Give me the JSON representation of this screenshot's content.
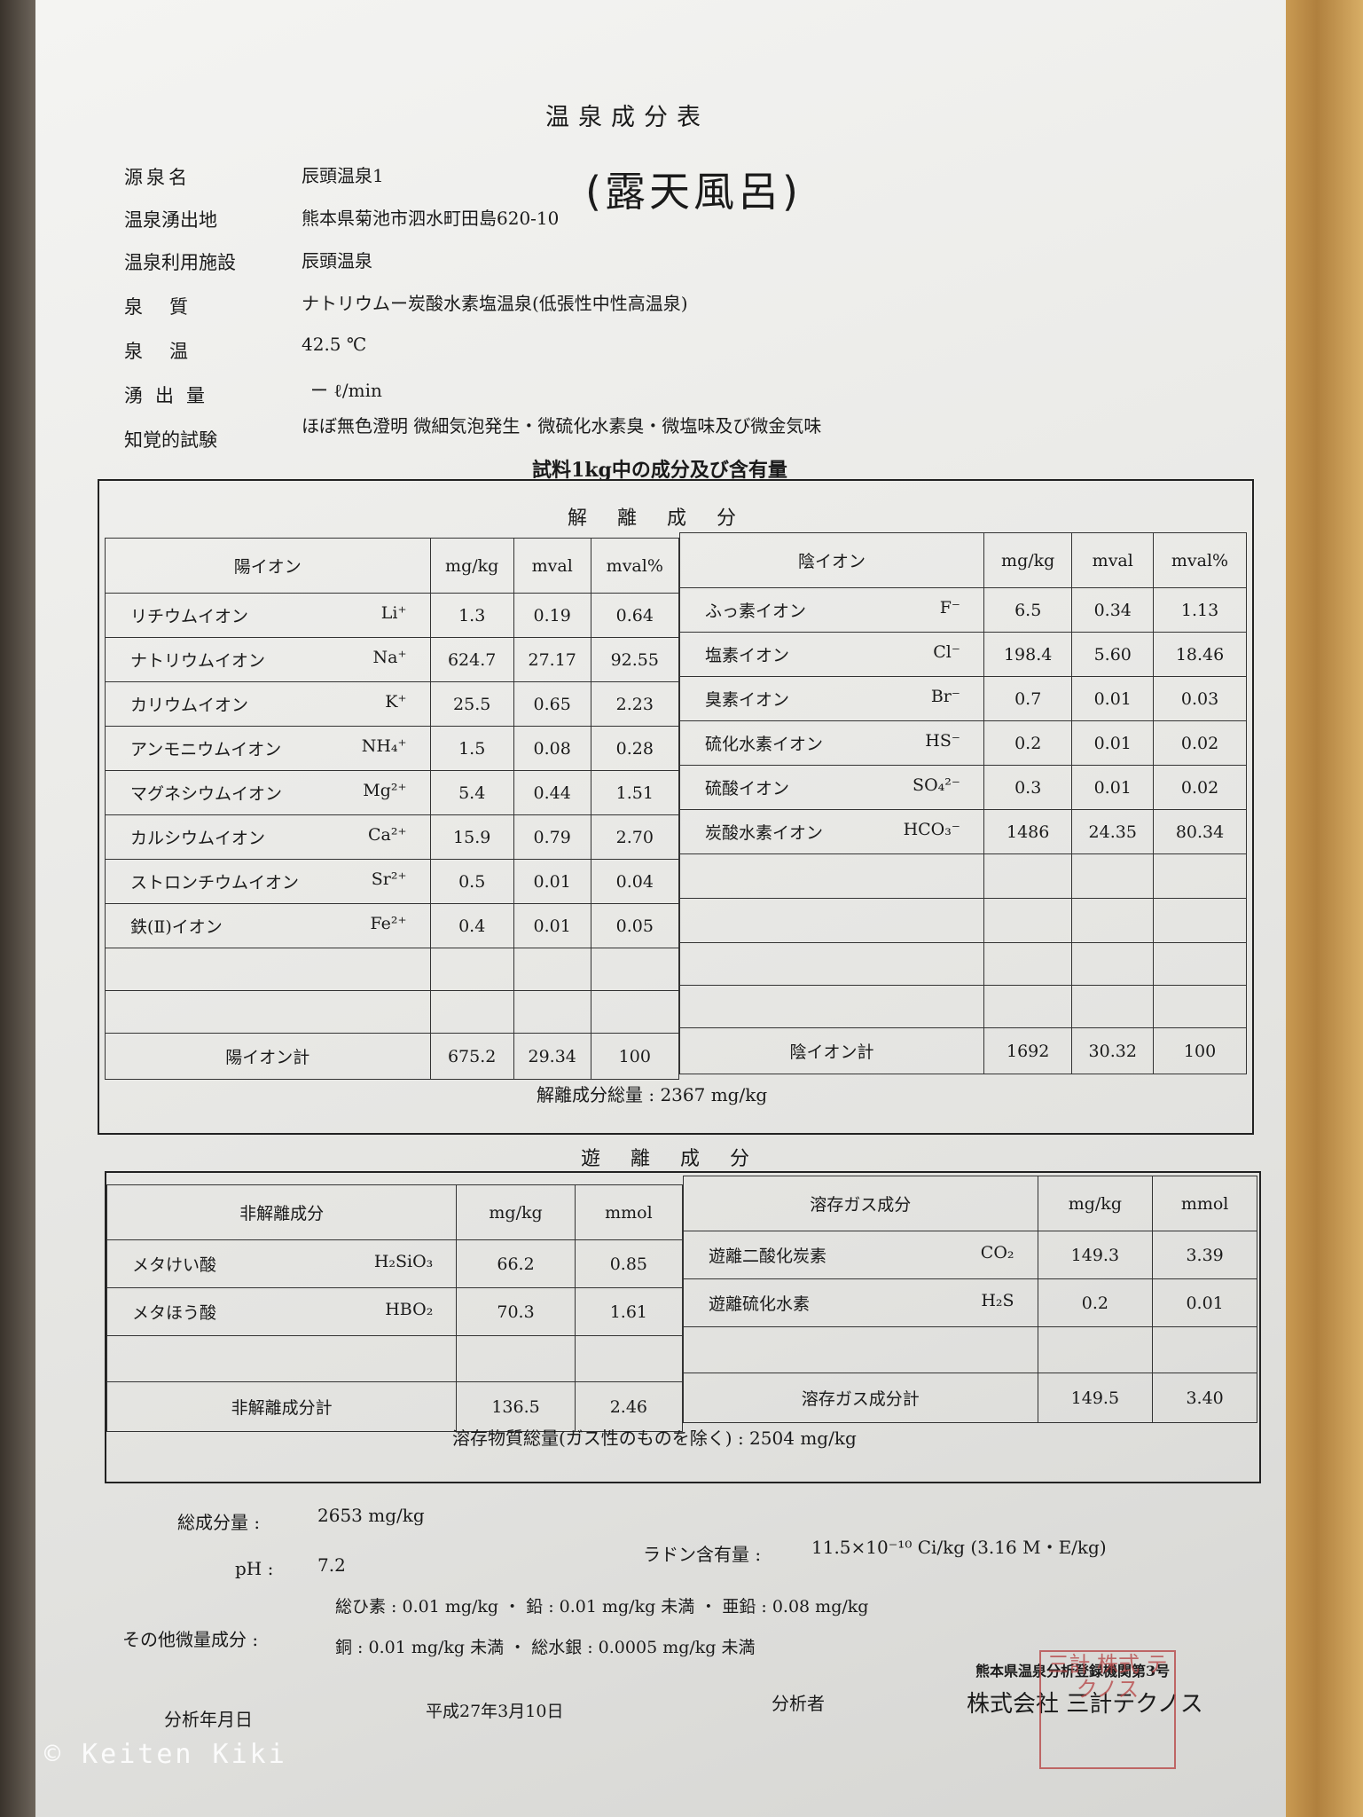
{
  "doc": {
    "title": "温泉成分表",
    "fields": [
      {
        "label": "源泉名",
        "value": "辰頭温泉1"
      },
      {
        "label": "温泉湧出地",
        "value": "熊本県菊池市泗水町田島620-10"
      },
      {
        "label": "温泉利用施設",
        "value": "辰頭温泉"
      },
      {
        "label": "泉質",
        "value": "ナトリウムー炭酸水素塩温泉(低張性中性高温泉)"
      },
      {
        "label": "泉温",
        "value": "42.5 ℃"
      },
      {
        "label": "湧出量",
        "value": "ー ℓ/min"
      },
      {
        "label": "知覚的試験",
        "value": "ほぼ無色澄明 微細気泡発生・微硫化水素臭・微塩味及び微金気味"
      }
    ],
    "handwritten": "(露天風呂)",
    "subtitle": "試料1kg中の成分及び含有量"
  },
  "dissociated": {
    "heading": "解離成分",
    "cat_headers": [
      "陽イオン",
      "mg/kg",
      "mval",
      "mval%"
    ],
    "an_headers": [
      "陰イオン",
      "mg/kg",
      "mval",
      "mval%"
    ],
    "cations": [
      {
        "name": "リチウムイオン",
        "sym": "Li⁺",
        "mg": "1.3",
        "mval": "0.19",
        "pct": "0.64"
      },
      {
        "name": "ナトリウムイオン",
        "sym": "Na⁺",
        "mg": "624.7",
        "mval": "27.17",
        "pct": "92.55"
      },
      {
        "name": "カリウムイオン",
        "sym": "K⁺",
        "mg": "25.5",
        "mval": "0.65",
        "pct": "2.23"
      },
      {
        "name": "アンモニウムイオン",
        "sym": "NH₄⁺",
        "mg": "1.5",
        "mval": "0.08",
        "pct": "0.28"
      },
      {
        "name": "マグネシウムイオン",
        "sym": "Mg²⁺",
        "mg": "5.4",
        "mval": "0.44",
        "pct": "1.51"
      },
      {
        "name": "カルシウムイオン",
        "sym": "Ca²⁺",
        "mg": "15.9",
        "mval": "0.79",
        "pct": "2.70"
      },
      {
        "name": "ストロンチウムイオン",
        "sym": "Sr²⁺",
        "mg": "0.5",
        "mval": "0.01",
        "pct": "0.04"
      },
      {
        "name": "鉄(Ⅱ)イオン",
        "sym": "Fe²⁺",
        "mg": "0.4",
        "mval": "0.01",
        "pct": "0.05"
      }
    ],
    "anions": [
      {
        "name": "ふっ素イオン",
        "sym": "F⁻",
        "mg": "6.5",
        "mval": "0.34",
        "pct": "1.13"
      },
      {
        "name": "塩素イオン",
        "sym": "Cl⁻",
        "mg": "198.4",
        "mval": "5.60",
        "pct": "18.46"
      },
      {
        "name": "臭素イオン",
        "sym": "Br⁻",
        "mg": "0.7",
        "mval": "0.01",
        "pct": "0.03"
      },
      {
        "name": "硫化水素イオン",
        "sym": "HS⁻",
        "mg": "0.2",
        "mval": "0.01",
        "pct": "0.02"
      },
      {
        "name": "硫酸イオン",
        "sym": "SO₄²⁻",
        "mg": "0.3",
        "mval": "0.01",
        "pct": "0.02"
      },
      {
        "name": "炭酸水素イオン",
        "sym": "HCO₃⁻",
        "mg": "1486",
        "mval": "24.35",
        "pct": "80.34"
      }
    ],
    "cat_total": {
      "label": "陽イオン計",
      "mg": "675.2",
      "mval": "29.34",
      "pct": "100"
    },
    "an_total": {
      "label": "陰イオン計",
      "mg": "1692",
      "mval": "30.32",
      "pct": "100"
    },
    "grand_total": "解離成分総量 : 2367 mg/kg"
  },
  "free": {
    "heading": "遊離成分",
    "nd_headers": [
      "非解離成分",
      "mg/kg",
      "mmol"
    ],
    "gas_headers": [
      "溶存ガス成分",
      "mg/kg",
      "mmol"
    ],
    "nondiss": [
      {
        "name": "メタけい酸",
        "sym": "H₂SiO₃",
        "mg": "66.2",
        "mmol": "0.85"
      },
      {
        "name": "メタほう酸",
        "sym": "HBO₂",
        "mg": "70.3",
        "mmol": "1.61"
      }
    ],
    "gases": [
      {
        "name": "遊離二酸化炭素",
        "sym": "CO₂",
        "mg": "149.3",
        "mmol": "3.39"
      },
      {
        "name": "遊離硫化水素",
        "sym": "H₂S",
        "mg": "0.2",
        "mmol": "0.01"
      }
    ],
    "nd_total": {
      "label": "非解離成分計",
      "mg": "136.5",
      "mmol": "2.46"
    },
    "gas_total": {
      "label": "溶存ガス成分計",
      "mg": "149.5",
      "mmol": "3.40"
    },
    "dissolved_total": "溶存物質総量(ガス性のものを除く) : 2504 mg/kg"
  },
  "footer": {
    "total_label": "総成分量 :",
    "total_value": "2653 mg/kg",
    "ph_label": "pH :",
    "ph_value": "7.2",
    "radon_label": "ラドン含有量 :",
    "radon_value": "11.5×10⁻¹⁰ Ci/kg (3.16 M・E/kg)",
    "trace_label": "その他微量成分 :",
    "trace_line1": "総ひ素 : 0.01 mg/kg ・ 鉛 : 0.01 mg/kg 未満 ・ 亜鉛 : 0.08 mg/kg",
    "trace_line2": "銅 : 0.01 mg/kg 未満 ・ 総水銀 : 0.0005 mg/kg 未満",
    "reg": "熊本県温泉分析登録機関第3号",
    "date_label": "分析年月日",
    "date_value": "平成27年3月10日",
    "analyst_label": "分析者",
    "analyst_value": "株式会社 三計テクノス",
    "stamp_text": "三計 株式 テクノス",
    "watermark": "© Keiten Kiki"
  }
}
